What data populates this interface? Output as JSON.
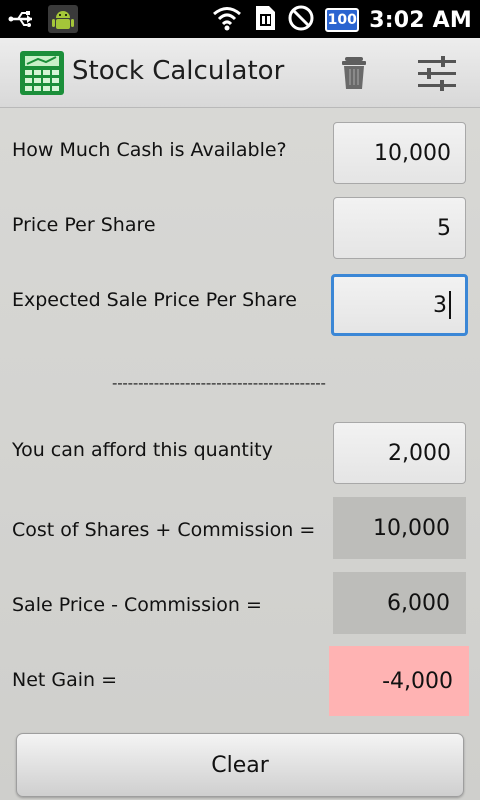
{
  "status_bar": {
    "time": "3:02 AM",
    "battery": "100",
    "icons": [
      "usb-icon",
      "android-icon",
      "wifi-icon",
      "sim-icon",
      "do-not-disturb-icon",
      "battery-icon"
    ]
  },
  "app_bar": {
    "title": "Stock Calculator",
    "icon": "calculator-icon",
    "actions": [
      "trash-icon",
      "sliders-icon"
    ]
  },
  "inputs": [
    {
      "label": "How Much Cash is Available?",
      "value": "10,000"
    },
    {
      "label": "Price Per Share",
      "value": "5"
    },
    {
      "label": "Expected Sale Price Per Share",
      "value": "3"
    }
  ],
  "separator": "-----------------------------------------",
  "results": [
    {
      "label": "You can afford this quantity",
      "value": "2,000"
    },
    {
      "label": "Cost of Shares + Commission =",
      "value": "10,000"
    },
    {
      "label": "Sale Price - Commission =",
      "value": "6,000"
    },
    {
      "label": "Net Gain =",
      "value": "-4,000"
    }
  ],
  "clear_label": "Clear",
  "colors": {
    "active_border": "#3b87d6",
    "loss_background": "#ffb3b3"
  }
}
